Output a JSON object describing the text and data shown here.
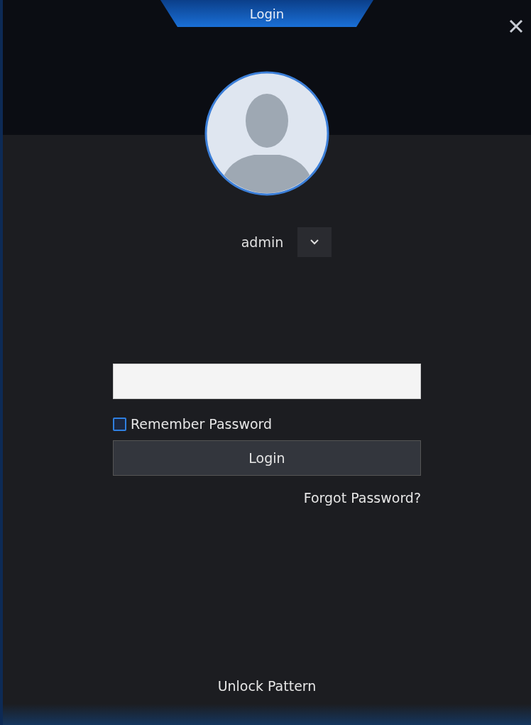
{
  "window": {
    "title": "Login"
  },
  "user": {
    "name": "admin"
  },
  "remember_password": {
    "label": "Remember Password",
    "checked": false
  },
  "login_button": {
    "label": "Login"
  },
  "forgot_password": {
    "label": "Forgot Password?"
  },
  "unlock_pattern": {
    "label": "Unlock Pattern"
  }
}
